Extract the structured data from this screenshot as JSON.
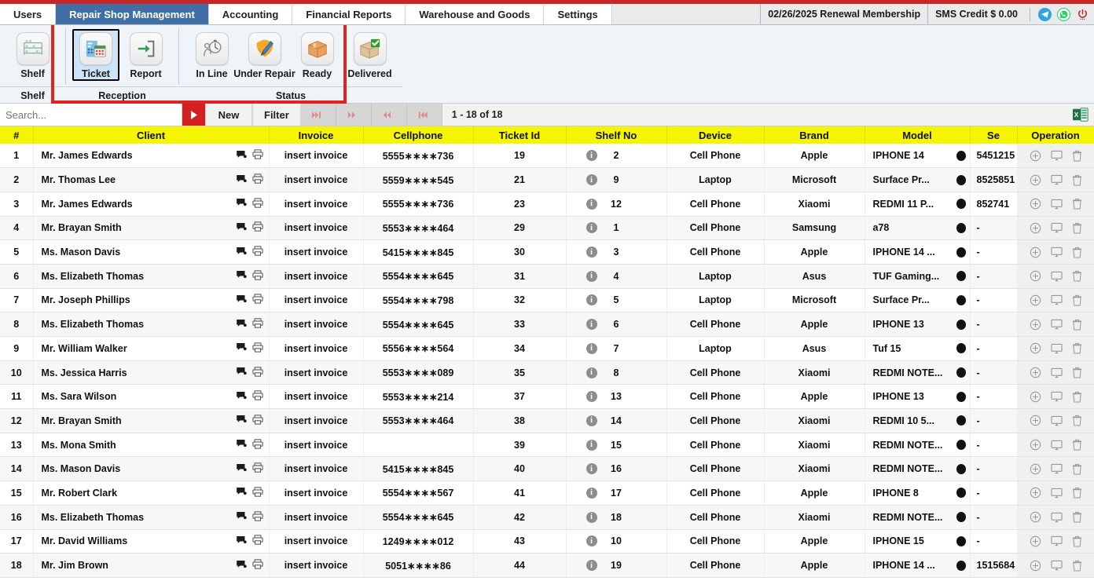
{
  "tabs": [
    {
      "label": "Users",
      "active": false
    },
    {
      "label": "Repair Shop Management",
      "active": true
    },
    {
      "label": "Accounting",
      "active": false
    },
    {
      "label": "Financial Reports",
      "active": false
    },
    {
      "label": "Warehouse and Goods",
      "active": false
    },
    {
      "label": "Settings",
      "active": false
    }
  ],
  "header_right": {
    "membership": "02/26/2025 Renewal Membership",
    "sms_credit": "SMS Credit $ 0.00",
    "telegram_icon": "telegram-icon",
    "whatsapp_icon": "whatsapp-icon",
    "power_icon": "power-icon"
  },
  "ribbon": {
    "groups": [
      {
        "title": "Shelf",
        "items": [
          {
            "label": "Shelf",
            "icon": "shelf-icon",
            "selected": false
          }
        ]
      },
      {
        "title": "Reception",
        "items": [
          {
            "label": "Ticket",
            "icon": "ticket-icon",
            "selected": true
          },
          {
            "label": "Report",
            "icon": "report-icon",
            "selected": false
          }
        ]
      },
      {
        "title": "Status",
        "items": [
          {
            "label": "In Line",
            "icon": "in-line-icon",
            "selected": false
          },
          {
            "label": "Under Repair",
            "icon": "under-repair-icon",
            "selected": false
          },
          {
            "label": "Ready",
            "icon": "ready-icon",
            "selected": false
          },
          {
            "label": "Delivered",
            "icon": "delivered-icon",
            "selected": false
          }
        ]
      }
    ]
  },
  "toolbar": {
    "search_placeholder": "Search...",
    "search_value": "",
    "search_go_icon": "play-icon",
    "new_label": "New",
    "filter_label": "Filter",
    "pager": {
      "last_icon": "skip-to-end-icon",
      "next_icon": "fast-forward-icon",
      "prev_icon": "rewind-icon",
      "first_icon": "skip-to-start-icon",
      "count_text": "1 - 18 of 18"
    },
    "excel_icon": "excel-export-icon"
  },
  "table": {
    "headers": [
      "#",
      "Client",
      "Invoice",
      "Cellphone",
      "Ticket Id",
      "Shelf No",
      "Device",
      "Brand",
      "Model",
      "Se",
      "Operation"
    ],
    "row_icons": {
      "chat_icon": "chat-icon",
      "print_icon": "print-icon",
      "info_icon": "info-icon",
      "status_dot": "status-dot-icon",
      "add_icon": "add-circle-icon",
      "monitor_icon": "monitor-icon",
      "delete_icon": "trash-icon"
    },
    "rows": [
      {
        "num": "1",
        "client": "Mr. James Edwards",
        "invoice": "insert invoice",
        "cellphone": "5555∗∗∗∗736",
        "ticket": "19",
        "shelf": "2",
        "device": "Cell Phone",
        "brand": "Apple",
        "model": "IPHONE 14",
        "serial": "5451215"
      },
      {
        "num": "2",
        "client": "Mr. Thomas Lee",
        "invoice": "insert invoice",
        "cellphone": "5559∗∗∗∗545",
        "ticket": "21",
        "shelf": "9",
        "device": "Laptop",
        "brand": "Microsoft",
        "model": "Surface Pr...",
        "serial": "8525851"
      },
      {
        "num": "3",
        "client": "Mr. James Edwards",
        "invoice": "insert invoice",
        "cellphone": "5555∗∗∗∗736",
        "ticket": "23",
        "shelf": "12",
        "device": "Cell Phone",
        "brand": "Xiaomi",
        "model": "REDMI 11 P...",
        "serial": "852741"
      },
      {
        "num": "4",
        "client": "Mr. Brayan Smith",
        "invoice": "insert invoice",
        "cellphone": "5553∗∗∗∗464",
        "ticket": "29",
        "shelf": "1",
        "device": "Cell Phone",
        "brand": "Samsung",
        "model": "a78",
        "serial": "-"
      },
      {
        "num": "5",
        "client": "Ms. Mason Davis",
        "invoice": "insert invoice",
        "cellphone": "5415∗∗∗∗845",
        "ticket": "30",
        "shelf": "3",
        "device": "Cell Phone",
        "brand": "Apple",
        "model": "IPHONE 14 ...",
        "serial": "-"
      },
      {
        "num": "6",
        "client": "Ms. Elizabeth Thomas",
        "invoice": "insert invoice",
        "cellphone": "5554∗∗∗∗645",
        "ticket": "31",
        "shelf": "4",
        "device": "Laptop",
        "brand": "Asus",
        "model": "TUF Gaming...",
        "serial": "-"
      },
      {
        "num": "7",
        "client": "Mr. Joseph Phillips",
        "invoice": "insert invoice",
        "cellphone": "5554∗∗∗∗798",
        "ticket": "32",
        "shelf": "5",
        "device": "Laptop",
        "brand": "Microsoft",
        "model": "Surface Pr...",
        "serial": "-"
      },
      {
        "num": "8",
        "client": "Ms. Elizabeth Thomas",
        "invoice": "insert invoice",
        "cellphone": "5554∗∗∗∗645",
        "ticket": "33",
        "shelf": "6",
        "device": "Cell Phone",
        "brand": "Apple",
        "model": "IPHONE 13",
        "serial": "-"
      },
      {
        "num": "9",
        "client": "Mr. William Walker",
        "invoice": "insert invoice",
        "cellphone": "5556∗∗∗∗564",
        "ticket": "34",
        "shelf": "7",
        "device": "Laptop",
        "brand": "Asus",
        "model": "Tuf 15",
        "serial": "-"
      },
      {
        "num": "10",
        "client": "Ms. Jessica Harris",
        "invoice": "insert invoice",
        "cellphone": "5553∗∗∗∗089",
        "ticket": "35",
        "shelf": "8",
        "device": "Cell Phone",
        "brand": "Xiaomi",
        "model": "REDMI NOTE...",
        "serial": "-"
      },
      {
        "num": "11",
        "client": "Ms. Sara Wilson",
        "invoice": "insert invoice",
        "cellphone": "5553∗∗∗∗214",
        "ticket": "37",
        "shelf": "13",
        "device": "Cell Phone",
        "brand": "Apple",
        "model": "IPHONE 13",
        "serial": "-"
      },
      {
        "num": "12",
        "client": "Mr. Brayan Smith",
        "invoice": "insert invoice",
        "cellphone": "5553∗∗∗∗464",
        "ticket": "38",
        "shelf": "14",
        "device": "Cell Phone",
        "brand": "Xiaomi",
        "model": "REDMI 10 5...",
        "serial": "-"
      },
      {
        "num": "13",
        "client": "Ms. Mona Smith",
        "invoice": "insert invoice",
        "cellphone": "",
        "ticket": "39",
        "shelf": "15",
        "device": "Cell Phone",
        "brand": "Xiaomi",
        "model": "REDMI NOTE...",
        "serial": "-"
      },
      {
        "num": "14",
        "client": "Ms. Mason Davis",
        "invoice": "insert invoice",
        "cellphone": "5415∗∗∗∗845",
        "ticket": "40",
        "shelf": "16",
        "device": "Cell Phone",
        "brand": "Xiaomi",
        "model": "REDMI NOTE...",
        "serial": "-"
      },
      {
        "num": "15",
        "client": "Mr. Robert Clark",
        "invoice": "insert invoice",
        "cellphone": "5554∗∗∗∗567",
        "ticket": "41",
        "shelf": "17",
        "device": "Cell Phone",
        "brand": "Apple",
        "model": "IPHONE 8",
        "serial": "-"
      },
      {
        "num": "16",
        "client": "Ms. Elizabeth Thomas",
        "invoice": "insert invoice",
        "cellphone": "5554∗∗∗∗645",
        "ticket": "42",
        "shelf": "18",
        "device": "Cell Phone",
        "brand": "Xiaomi",
        "model": "REDMI NOTE...",
        "serial": "-"
      },
      {
        "num": "17",
        "client": "Mr. David Williams",
        "invoice": "insert invoice",
        "cellphone": "1249∗∗∗∗012",
        "ticket": "43",
        "shelf": "10",
        "device": "Cell Phone",
        "brand": "Apple",
        "model": "IPHONE 15",
        "serial": "-"
      },
      {
        "num": "18",
        "client": "Mr. Jim Brown",
        "invoice": "insert invoice",
        "cellphone": "5051∗∗∗∗86",
        "ticket": "44",
        "shelf": "19",
        "device": "Cell Phone",
        "brand": "Apple",
        "model": "IPHONE 14 ...",
        "serial": "1515684"
      }
    ]
  },
  "colors": {
    "header_yellow": "#f5f500",
    "active_tab_blue": "#3f6fa5",
    "accent_red": "#c62828",
    "highlight_red": "#e02222"
  }
}
